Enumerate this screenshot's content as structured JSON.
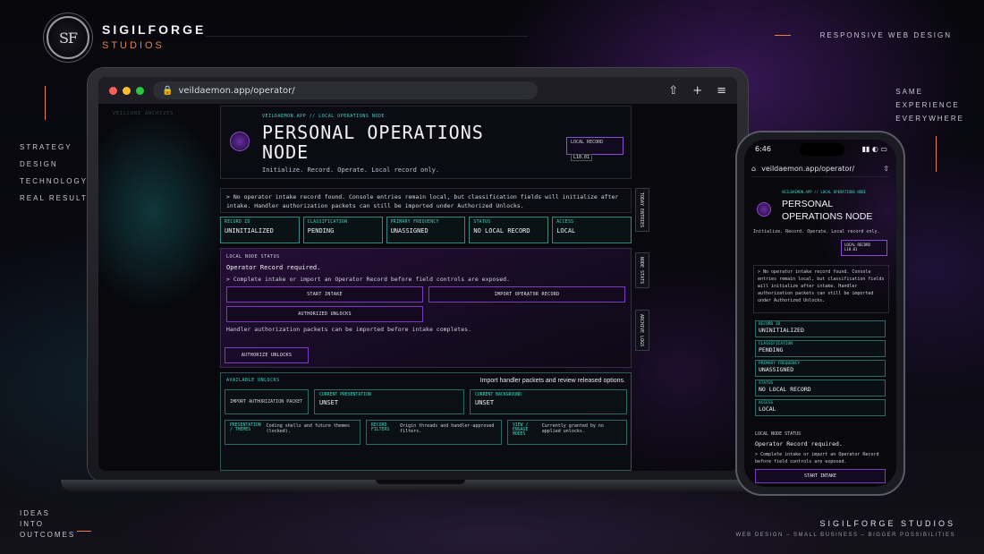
{
  "brand": {
    "monogram": "SF",
    "name": "SIGILFORGE",
    "sub": "STUDIOS"
  },
  "corner_labels": {
    "top_right": "RESPONSIVE WEB DESIGN",
    "right_lines": [
      "SAME",
      "EXPERIENCE",
      "EVERYWHERE"
    ],
    "left_lines": [
      "STRATEGY",
      "DESIGN",
      "TECHNOLOGY",
      "REAL RESULTS"
    ],
    "bottom_left_lines": [
      "IDEAS",
      "INTO",
      "OUTCOMES"
    ]
  },
  "footer": {
    "title": "SIGILFORGE STUDIOS",
    "tagline": "WEB DESIGN – SMALL BUSINESS – BIGGER POSSIBILITIES"
  },
  "browser": {
    "url": "veildaemon.app/operator/",
    "actions": [
      "share-icon",
      "plus-icon",
      "menu-icon"
    ]
  },
  "ghost_label": "VEILCORE ARCHIVES",
  "desktop": {
    "crumb": "VEILDAEMON.APP // LOCAL OPERATIONS NODE",
    "title_line1": "PERSONAL OPERATIONS",
    "title_line2": "NODE",
    "subtitle": "Initialize. Record. Operate. Local record only.",
    "badge_label": "LOCAL RECORD",
    "badge_value": "L10.01",
    "notice": "> No operator intake record found. Console entries remain local, but classification fields will initialize after intake. Handler authorization packets can still be imported under Authorized Unlocks.",
    "stats": [
      {
        "key": "RECORD ID",
        "value": "UNINITIALIZED"
      },
      {
        "key": "CLASSIFICATION",
        "value": "PENDING"
      },
      {
        "key": "PRIMARY FREQUENCY",
        "value": "UNASSIGNED"
      },
      {
        "key": "STATUS",
        "value": "NO LOCAL RECORD"
      },
      {
        "key": "ACCESS",
        "value": "LOCAL"
      }
    ],
    "status": {
      "label": "LOCAL NODE STATUS",
      "title": "Operator Record required.",
      "note": "> Complete intake or import an Operator Record before field controls are exposed.",
      "btn_start": "START INTAKE",
      "btn_import": "IMPORT OPERATOR RECORD",
      "btn_authorized": "AUTHORIZED UNLOCKS",
      "helper": "Handler authorization packets can be imported before intake completes.",
      "btn_authorize": "AUTHORIZE UNLOCKS"
    },
    "unlocks": {
      "label": "AVAILABLE UNLOCKS",
      "note": "Import handler packets and review released options.",
      "import_btn": "IMPORT AUTHORIZATION PACKET",
      "presentation_key": "CURRENT PRESENTATION",
      "presentation_value": "UNSET",
      "background_key": "CURRENT BACKGROUND",
      "background_value": "UNSET",
      "row": [
        {
          "key": "PRESENTATION / THEMES",
          "text": "Coding shells and future themes (locked)."
        },
        {
          "key": "RECORD FILTERS",
          "text": "Origin threads and handler-approved filters."
        },
        {
          "key": "VIEW / ENGAGE MODES",
          "text": "Currently granted by no applied unlocks."
        }
      ]
    },
    "side_tabs": [
      "TODAY ENTRIES",
      "NODE STATS",
      "ARCHIVE LOGS"
    ]
  },
  "phone": {
    "time": "6:46",
    "url": "veildaemon.app/operator/",
    "crumb": "VEILDAEMON.APP // LOCAL OPERATIONS NODE",
    "title_line1": "PERSONAL",
    "title_line2": "OPERATIONS NODE",
    "subtitle": "Initialize. Record. Operate. Local record only.",
    "badge_label": "LOCAL RECORD",
    "badge_value": "L10.01",
    "notice": "> No operator intake record found. Console entries remain local, but classification fields will initialize after intake. Handler authorization packets can still be imported under Authorized Unlocks.",
    "stats": [
      {
        "key": "RECORD ID",
        "value": "UNINITIALIZED"
      },
      {
        "key": "CLASSIFICATION",
        "value": "PENDING"
      },
      {
        "key": "PRIMARY FREQUENCY",
        "value": "UNASSIGNED"
      },
      {
        "key": "STATUS",
        "value": "NO LOCAL RECORD"
      },
      {
        "key": "ACCESS",
        "value": "LOCAL"
      }
    ],
    "node_label": "LOCAL NODE STATUS",
    "node_title": "Operator Record required.",
    "node_note": "> Complete intake or import an Operator Record before field controls are exposed.",
    "btn_start": "START INTAKE"
  },
  "colors": {
    "accent_orange": "#e8813c",
    "accent_teal": "#3dd6c0",
    "accent_purple": "#7a3dc0"
  }
}
